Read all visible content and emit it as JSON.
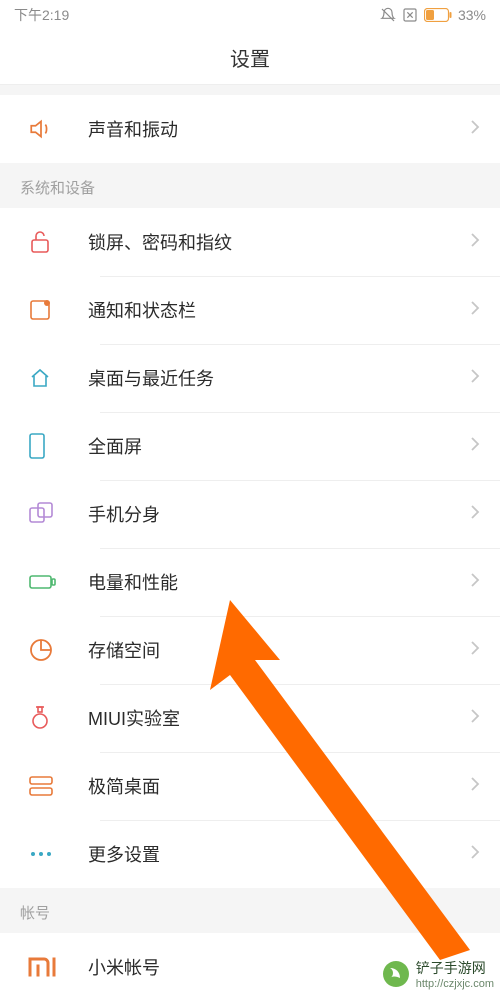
{
  "status": {
    "time": "下午2:19",
    "battery_pct": "33%"
  },
  "header": {
    "title": "设置"
  },
  "sections": {
    "top": {
      "sound_label": "声音和振动"
    },
    "system": {
      "header": "系统和设备",
      "lock_label": "锁屏、密码和指纹",
      "notif_label": "通知和状态栏",
      "desktop_label": "桌面与最近任务",
      "fullscreen_label": "全面屏",
      "dual_label": "手机分身",
      "battery_label": "电量和性能",
      "storage_label": "存储空间",
      "lab_label": "MIUI实验室",
      "simple_label": "极简桌面",
      "more_label": "更多设置"
    },
    "account": {
      "header": "帐号",
      "xiaomi_label": "小米帐号"
    }
  },
  "watermark": {
    "name": "铲子手游网",
    "url": "http://czjxjc.com"
  }
}
